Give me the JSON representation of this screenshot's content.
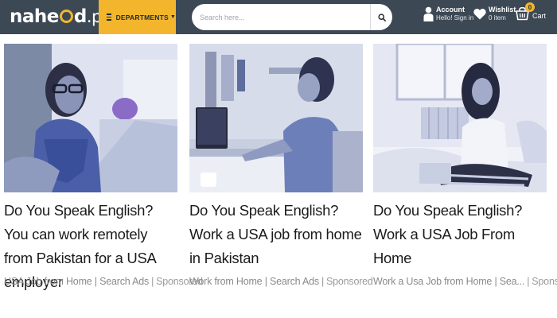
{
  "header": {
    "logo": {
      "part1": "nahe",
      "part2": "d",
      "tld": ".pk"
    },
    "departments_label": "DEPARTMENTS",
    "search": {
      "placeholder": "Search here..."
    },
    "account": {
      "title": "Account",
      "subtitle": "Hello! Sign in"
    },
    "wishlist": {
      "title": "Wishlist",
      "subtitle": "0 item"
    },
    "cart": {
      "label": "Cart",
      "count": "0"
    },
    "colors": {
      "bar": "#3d4855",
      "accent": "#f2b52c"
    }
  },
  "ads": [
    {
      "title": "Do You Speak English? You can work remotely from Pakistan for a USA employer",
      "source": "USA Job from Home | Search Ads",
      "sponsored": "Sponsored"
    },
    {
      "title": "Do You Speak English? Work a USA job from home in Pakistan",
      "source": "Work from Home | Search Ads",
      "sponsored": "Sponsored"
    },
    {
      "title": "Do You Speak English? Work a USA Job From Home",
      "source": "Work a Usa Job from Home | Sea...",
      "sponsored": "Sponsored"
    }
  ]
}
